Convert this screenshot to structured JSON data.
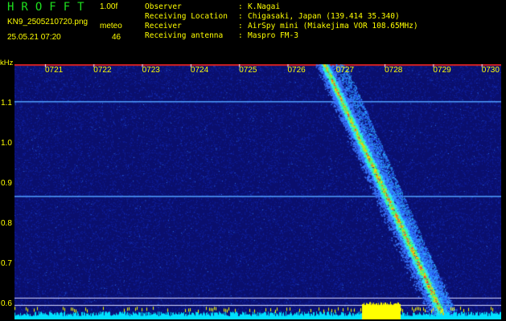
{
  "header": {
    "app_title": "HROFFT",
    "version": "1.00f",
    "filename": "KN9_2505210720.png",
    "datetime": "25.05.21 07:20",
    "meteo_label": "meteo",
    "meteo_count": "46"
  },
  "info": [
    {
      "key": "Observer",
      "value": "K.Nagai"
    },
    {
      "key": "Receiving Location",
      "value": "Chigasaki, Japan (139.414 35.340)"
    },
    {
      "key": "Receiver",
      "value": "AirSpy mini (Miakejima VOR 108.65MHz)"
    },
    {
      "key": "Receiving antenna",
      "value": "Maspro FM-3"
    }
  ],
  "axis": {
    "unit": "kHz",
    "freq_ticks": [
      "1.1",
      "1.0",
      "0.9",
      "0.8",
      "0.7",
      "0.6"
    ],
    "time_ticks": [
      "0721",
      "0722",
      "0723",
      "0724",
      "0725",
      "0726",
      "0727",
      "0728",
      "0729",
      "0730"
    ]
  },
  "colors": {
    "label": "#ffff00",
    "title": "#1ee01e",
    "background": "#0a0f6e",
    "baseline": "#00e0ff"
  }
}
